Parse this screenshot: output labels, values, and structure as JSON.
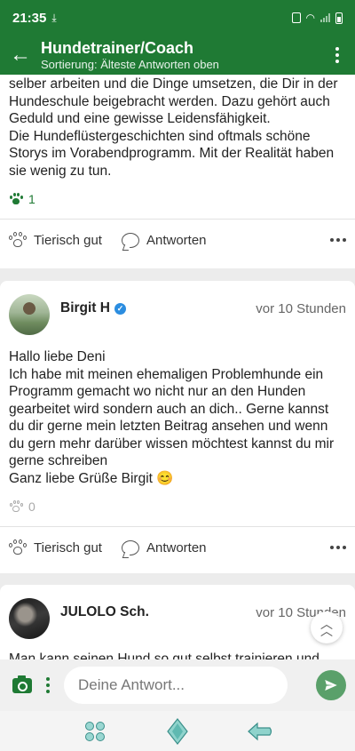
{
  "status_bar": {
    "time": "21:35"
  },
  "app_bar": {
    "title": "Hundetrainer/Coach",
    "subtitle": "Sortierung: Älteste Antworten oben"
  },
  "posts": [
    {
      "text": "selber arbeiten und die Dinge umsetzen, die Dir in der Hundeschule beigebracht werden. Dazu gehört auch Geduld und eine gewisse Leidensfähigkeit.\nDie Hundeflüstergeschichten sind oftmals schöne Storys im Vorabendprogramm. Mit der Realität haben sie wenig zu tun.",
      "likes": "1",
      "like_label": "Tierisch gut",
      "reply_label": "Antworten"
    },
    {
      "author": "Birgit H",
      "time": "vor 10 Stunden",
      "text": "Hallo liebe Deni\nIch habe mit meinen ehemaligen Problemhunde ein Programm gemacht wo nicht nur an den Hunden gearbeitet wird sondern auch an dich.. Gerne kannst du dir gerne mein letzten Beitrag ansehen und wenn du gern mehr darüber wissen möchtest kannst du mir gerne schreiben\nGanz liebe Grüße Birgit 😊",
      "likes": "0",
      "like_label": "Tierisch gut",
      "reply_label": "Antworten"
    },
    {
      "author": "JULOLO Sch.",
      "time": "vor 10 Stunden",
      "text": "Man kann seinen Hund so gut selbst trainieren und"
    }
  ],
  "composer": {
    "placeholder": "Deine Antwort..."
  },
  "colors": {
    "brand": "#1f7a34",
    "send": "#5aa06a",
    "verified": "#2b8de0"
  }
}
